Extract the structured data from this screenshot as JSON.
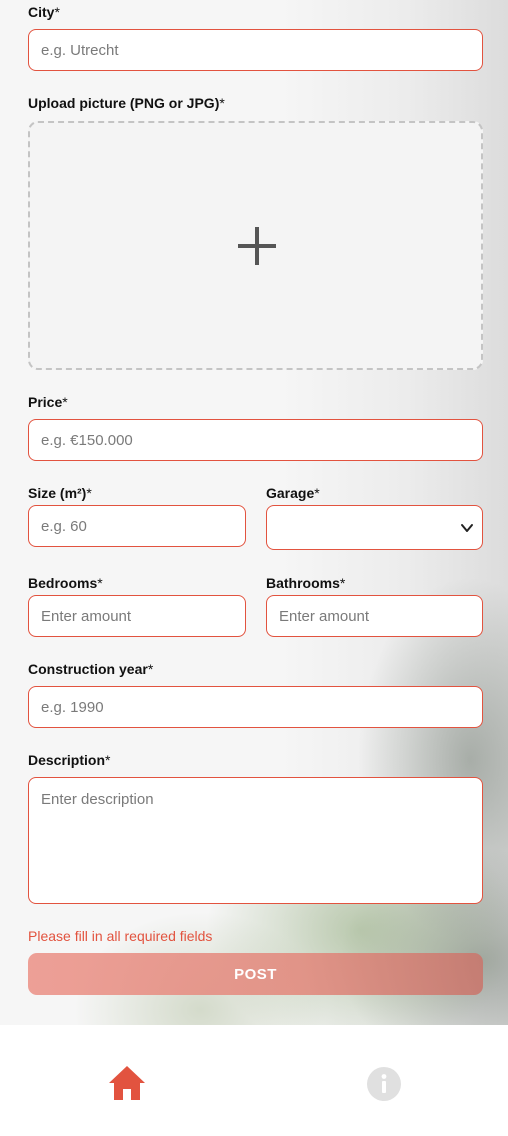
{
  "form": {
    "city": {
      "label": "City",
      "required_mark": "*",
      "placeholder": "e.g. Utrecht"
    },
    "upload": {
      "label": "Upload picture (PNG or JPG)",
      "required_mark": "*",
      "icon": "plus-icon"
    },
    "price": {
      "label": "Price",
      "required_mark": "*",
      "placeholder": "e.g. €150.000"
    },
    "size": {
      "label": "Size (m²)",
      "required_mark": "*",
      "placeholder": "e.g. 60"
    },
    "garage": {
      "label": "Garage",
      "required_mark": "*",
      "value": "",
      "icon": "chevron-down-icon"
    },
    "bedrooms": {
      "label": "Bedrooms",
      "required_mark": "*",
      "placeholder": "Enter amount"
    },
    "bathrooms": {
      "label": "Bathrooms",
      "required_mark": "*",
      "placeholder": "Enter amount"
    },
    "construction_year": {
      "label": "Construction year",
      "required_mark": "*",
      "placeholder": "e.g. 1990"
    },
    "description": {
      "label": "Description",
      "required_mark": "*",
      "placeholder": "Enter description"
    },
    "error_message": "Please fill in all required fields",
    "post_label": "POST"
  },
  "navbar": {
    "home_icon": "home-icon",
    "info_icon": "info-icon"
  },
  "colors": {
    "accent": "#e2533f",
    "post_button": "#e8968c",
    "icon_gray": "#e0e0e0"
  }
}
